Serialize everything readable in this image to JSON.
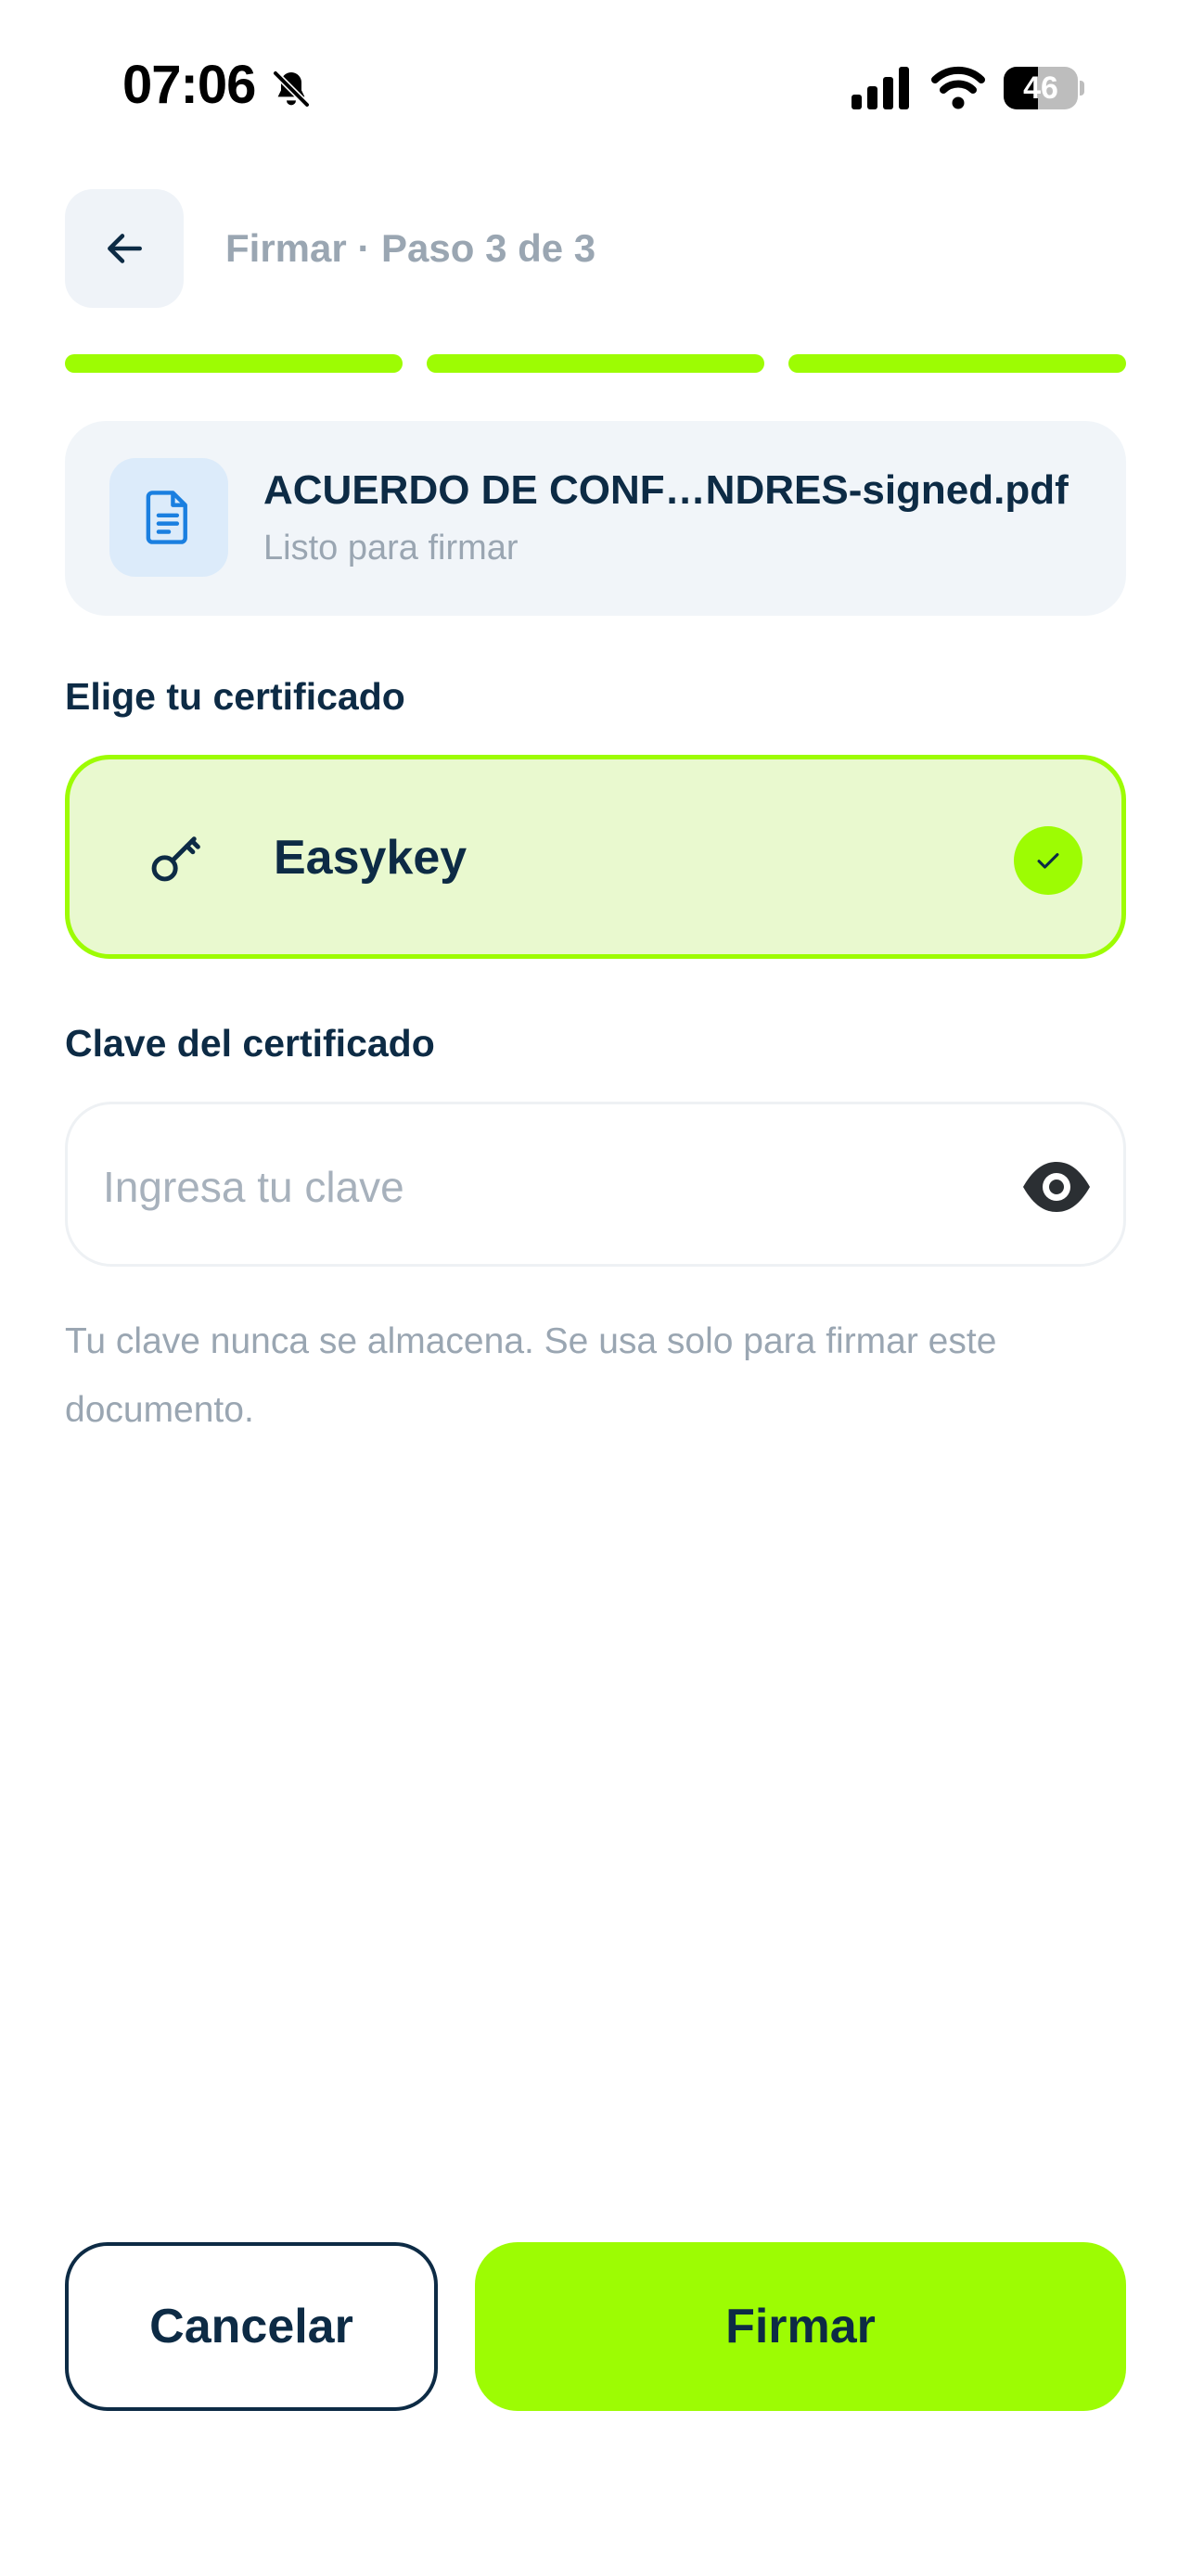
{
  "status_bar": {
    "time": "07:06",
    "battery_level": "46",
    "battery_fraction": 0.46,
    "icons": [
      "bell-slash-icon",
      "cellular-signal-icon",
      "wifi-icon",
      "battery-icon"
    ]
  },
  "header": {
    "back_icon": "arrow-left-icon",
    "title": "Firmar · Paso 3 de 3"
  },
  "progress": {
    "current_step": 3,
    "total_steps": 3,
    "completed_color": "#9dfc03"
  },
  "file": {
    "icon": "document-icon",
    "name": "ACUERDO DE CONF…NDRES-signed.pdf",
    "status": "Listo para firmar"
  },
  "certificate_section": {
    "label": "Elige tu certificado",
    "options": [
      {
        "name": "Easykey",
        "icon": "key-icon",
        "selected": true
      }
    ]
  },
  "password_section": {
    "label": "Clave del certificado",
    "placeholder": "Ingresa tu clave",
    "value": "",
    "toggle_icon": "eye-icon",
    "hint": "Tu clave nunca se almacena. Se usa solo para firmar este documento."
  },
  "actions": {
    "cancel_label": "Cancelar",
    "sign_label": "Firmar"
  },
  "colors": {
    "accent": "#9dfc03",
    "primary_text": "#0d2b45",
    "muted_text": "#9aa6b2"
  }
}
